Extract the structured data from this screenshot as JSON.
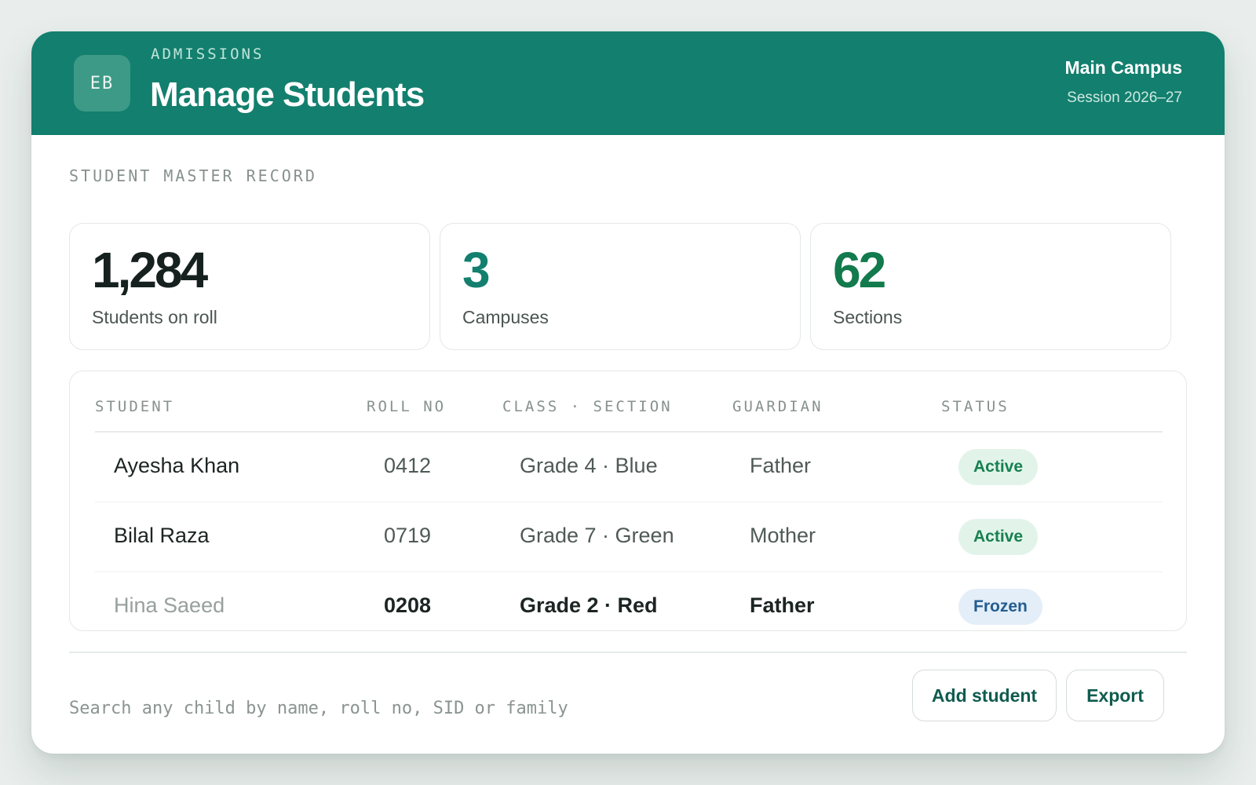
{
  "header": {
    "logo_initials": "EB",
    "eyebrow": "ADMISSIONS",
    "title": "Manage Students",
    "campus": "Main Campus",
    "session": "Session 2026–27"
  },
  "section_label": "STUDENT MASTER RECORD",
  "stats": [
    {
      "value": "1,284",
      "label": "Students on roll",
      "color": "#16211f"
    },
    {
      "value": "3",
      "label": "Campuses",
      "color": "#137f6e"
    },
    {
      "value": "62",
      "label": "Sections",
      "color": "#127a4c"
    }
  ],
  "table": {
    "columns": [
      "STUDENT",
      "ROLL NO",
      "CLASS · SECTION",
      "GUARDIAN",
      "STATUS"
    ],
    "rows": [
      {
        "student": "Ayesha Khan",
        "roll": "0412",
        "class_section": "Grade 4 · Blue",
        "guardian": "Father",
        "status": "Active"
      },
      {
        "student": "Bilal Raza",
        "roll": "0719",
        "class_section": "Grade 7 · Green",
        "guardian": "Mother",
        "status": "Active"
      },
      {
        "student": "Hina Saeed",
        "roll": "0208",
        "class_section": "Grade 2 · Red",
        "guardian": "Father",
        "status": "Frozen"
      }
    ]
  },
  "search": {
    "placeholder": "Search any child by name, roll no, SID or family"
  },
  "actions": {
    "add_label": "Add student",
    "export_label": "Export"
  },
  "colors": {
    "brand": "#137f6e",
    "active_badge": "#18804f",
    "frozen_badge": "#245d8e"
  }
}
